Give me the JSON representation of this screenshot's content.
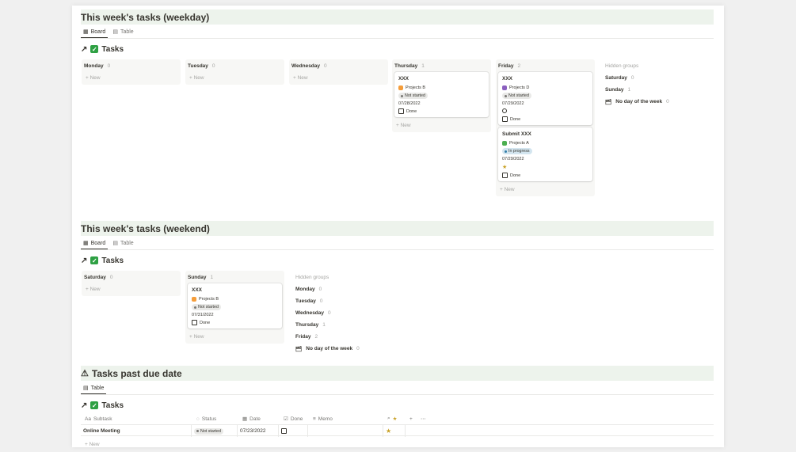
{
  "weekday": {
    "title": "This week's tasks (weekday)",
    "tabs": [
      {
        "label": "Board",
        "icon": "board-icon"
      },
      {
        "label": "Table",
        "icon": "table-icon"
      }
    ],
    "db_title": "Tasks",
    "new_label": "+ New",
    "columns": [
      {
        "name": "Monday",
        "count": "0"
      },
      {
        "name": "Tuesday",
        "count": "0"
      },
      {
        "name": "Wednesday",
        "count": "0"
      },
      {
        "name": "Thursday",
        "count": "1"
      },
      {
        "name": "Friday",
        "count": "2"
      }
    ],
    "cards": [
      {
        "title": "XXX",
        "project": "Projects B",
        "project_color": "#f59d3a",
        "status": "Not started",
        "date": "07/28/2022",
        "done": "Done"
      },
      {
        "title": "XXX",
        "project": "Projects D",
        "project_color": "#8b5fbf",
        "status": "Not started",
        "date": "07/29/2022",
        "done": "Done"
      },
      {
        "title": "Submit XXX",
        "project": "Projects A",
        "project_color": "#4caf50",
        "status": "In progress",
        "date": "07/29/2022",
        "done": "Done"
      }
    ],
    "hidden": {
      "label": "Hidden groups",
      "groups": [
        {
          "name": "Saturday",
          "count": "0"
        },
        {
          "name": "Sunday",
          "count": "1"
        },
        {
          "name": "No day of the week",
          "count": "0"
        }
      ]
    }
  },
  "weekend": {
    "title": "This week's tasks (weekend)",
    "tabs": [
      {
        "label": "Board",
        "icon": "board-icon"
      },
      {
        "label": "Table",
        "icon": "table-icon"
      }
    ],
    "db_title": "Tasks",
    "new_label": "+ New",
    "columns": [
      {
        "name": "Saturday",
        "count": "0"
      },
      {
        "name": "Sunday",
        "count": "1"
      }
    ],
    "cards": [
      {
        "title": "XXX",
        "project": "Projects B",
        "project_color": "#f59d3a",
        "status": "Not started",
        "date": "07/31/2022",
        "done": "Done"
      }
    ],
    "hidden": {
      "label": "Hidden groups",
      "groups": [
        {
          "name": "Monday",
          "count": "0"
        },
        {
          "name": "Tuesday",
          "count": "0"
        },
        {
          "name": "Wednesday",
          "count": "0"
        },
        {
          "name": "Thursday",
          "count": "1"
        },
        {
          "name": "Friday",
          "count": "2"
        },
        {
          "name": "No day of the week",
          "count": "0"
        }
      ]
    }
  },
  "past_due": {
    "title": "Tasks past due date",
    "tabs": [
      {
        "label": "Table",
        "icon": "table-icon"
      }
    ],
    "db_title": "Tasks",
    "new_label": "+ New",
    "columns": [
      "Subtask",
      "Status",
      "Date",
      "Done",
      "Memo"
    ],
    "rows": [
      {
        "subtask": "Online Meeting",
        "status": "Not started",
        "date": "07/23/2022"
      }
    ]
  }
}
